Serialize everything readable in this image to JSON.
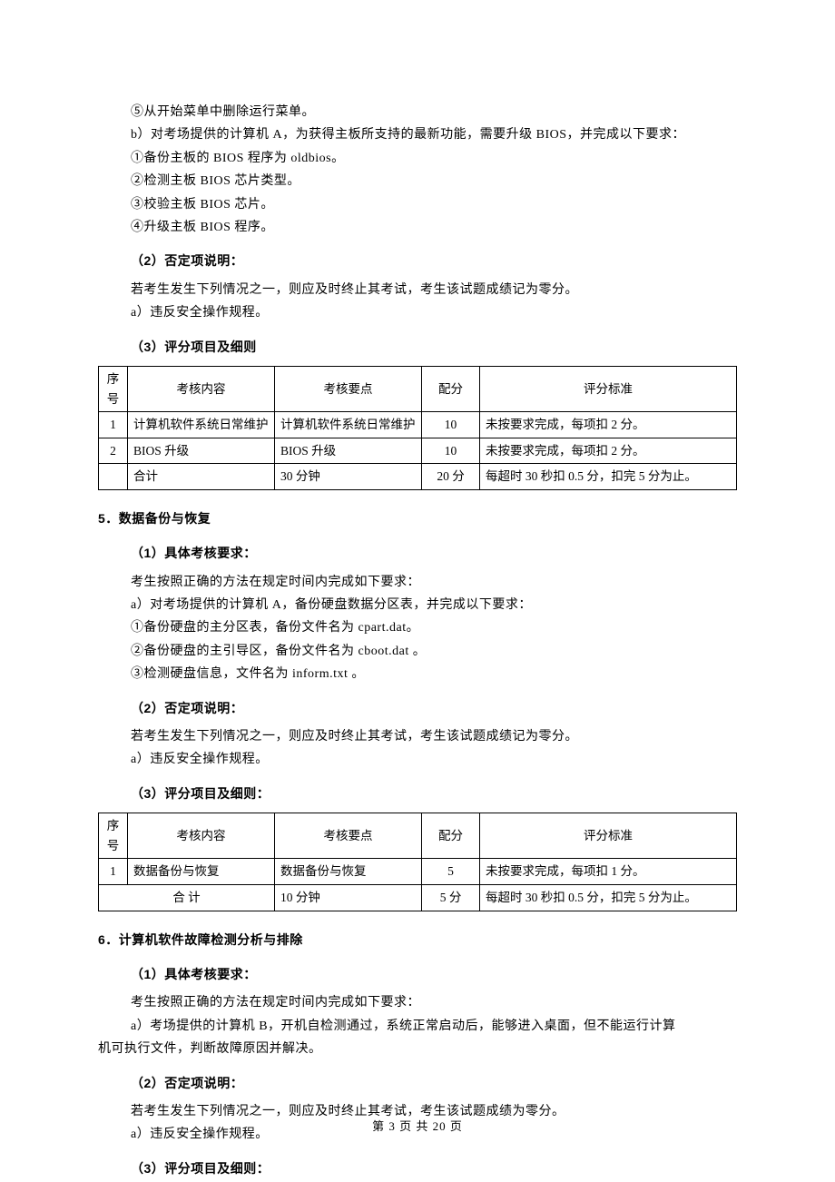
{
  "top": {
    "l1": "⑤从开始菜单中删除运行菜单。",
    "l2": "b）对考场提供的计算机 A，为获得主板所支持的最新功能，需要升级 BIOS，并完成以下要求：",
    "l3": "①备份主板的 BIOS 程序为 oldbios。",
    "l4": "②检测主板 BIOS 芯片类型。",
    "l5": "③校验主板 BIOS 芯片。",
    "l6": "④升级主板 BIOS 程序。",
    "neg_head": "（2）否定项说明：",
    "neg1": "若考生发生下列情况之一，则应及时终止其考试，考生该试题成绩记为零分。",
    "neg2": " a）违反安全操作规程。",
    "score_head": "（3）评分项目及细则"
  },
  "table1": {
    "h1": "序号",
    "h2": "考核内容",
    "h3": "考核要点",
    "h4": "配分",
    "h5": "评分标准",
    "rows": [
      {
        "seq": "1",
        "name": "计算机软件系统日常维护",
        "point": "计算机软件系统日常维护",
        "score": "10",
        "std": "未按要求完成，每项扣 2 分。"
      },
      {
        "seq": "2",
        "name": "BIOS 升级",
        "point": "BIOS 升级",
        "score": "10",
        "std": "未按要求完成，每项扣 2 分。"
      }
    ],
    "total": {
      "name": "合计",
      "point": "30 分钟",
      "score": "20 分",
      "std": "每超时 30 秒扣 0.5 分，扣完 5 分为止。"
    }
  },
  "sec5": {
    "title": "5．数据备份与恢复",
    "req_head": "（1）具体考核要求：",
    "req1": "考生按照正确的方法在规定时间内完成如下要求：",
    "req2": "a）对考场提供的计算机 A，备份硬盘数据分区表，并完成以下要求：",
    "req3": "①备份硬盘的主分区表，备份文件名为 cpart.dat。",
    "req4": "②备份硬盘的主引导区，备份文件名为 cboot.dat  。",
    "req5": "③检测硬盘信息，文件名为 inform.txt  。",
    "neg_head": "（2）否定项说明：",
    "neg1": "若考生发生下列情况之一，则应及时终止其考试，考生该试题成绩记为零分。",
    "neg2": "a）违反安全操作规程。",
    "score_head": "（3）评分项目及细则："
  },
  "table2": {
    "h1": "序号",
    "h2": "考核内容",
    "h3": "考核要点",
    "h4": "配分",
    "h5": "评分标准",
    "rows": [
      {
        "seq": "1",
        "name": "数据备份与恢复",
        "point": "数据备份与恢复",
        "score": "5",
        "std": "未按要求完成，每项扣 1 分。"
      }
    ],
    "total": {
      "name": "合  计",
      "point": "10 分钟",
      "score": "5 分",
      "std": "每超时 30 秒扣 0.5 分，扣完 5 分为止。"
    }
  },
  "sec6": {
    "title": "6．计算机软件故障检测分析与排除",
    "req_head": "（1）具体考核要求：",
    "req1": "考生按照正确的方法在规定时间内完成如下要求：",
    "req2_a": "a）考场提供的计算机 B，开机自检测通过，系统正常启动后，能够进入桌面，但不能运行计算",
    "req2_b": "机可执行文件，判断故障原因并解决。",
    "neg_head": "（2）否定项说明：",
    "neg1": "若考生发生下列情况之一，则应及时终止其考试，考生该试题成绩为零分。",
    "neg2": "a）违反安全操作规程。",
    "score_head": "（3）评分项目及细则："
  },
  "footer": "第 3 页 共 20 页"
}
